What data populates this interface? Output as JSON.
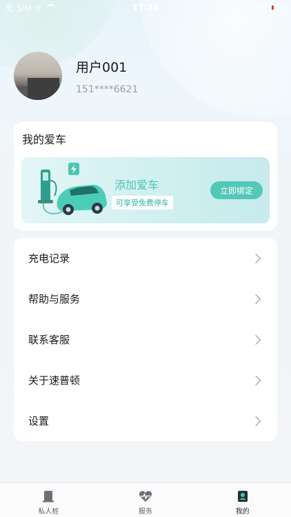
{
  "status_bar": {
    "carrier": "无 SIM 卡",
    "time": "17:20",
    "battery": "1%"
  },
  "profile": {
    "name": "用户001",
    "phone": "151****6621"
  },
  "my_car": {
    "title": "我的爱车",
    "banner_title": "添加爱车",
    "banner_subtitle": "可享受免费停车",
    "bind_button": "立即绑定"
  },
  "menu": {
    "items": [
      {
        "label": "充电记录",
        "icon": "chevron-right-icon"
      },
      {
        "label": "帮助与服务",
        "icon": "chevron-right-icon"
      },
      {
        "label": "联系客服",
        "icon": "chevron-right-icon"
      },
      {
        "label": "关于速普顿",
        "icon": "chevron-right-icon"
      },
      {
        "label": "设置",
        "icon": "chevron-right-icon"
      }
    ]
  },
  "tabs": [
    {
      "label": "私人桩",
      "icon": "charger-icon",
      "active": false
    },
    {
      "label": "服务",
      "icon": "heart-pulse-icon",
      "active": false
    },
    {
      "label": "我的",
      "icon": "profile-icon",
      "active": true
    }
  ],
  "colors": {
    "accent": "#54c8b7",
    "accent_text": "#4cc5b4",
    "background": "#f3f5f8"
  }
}
